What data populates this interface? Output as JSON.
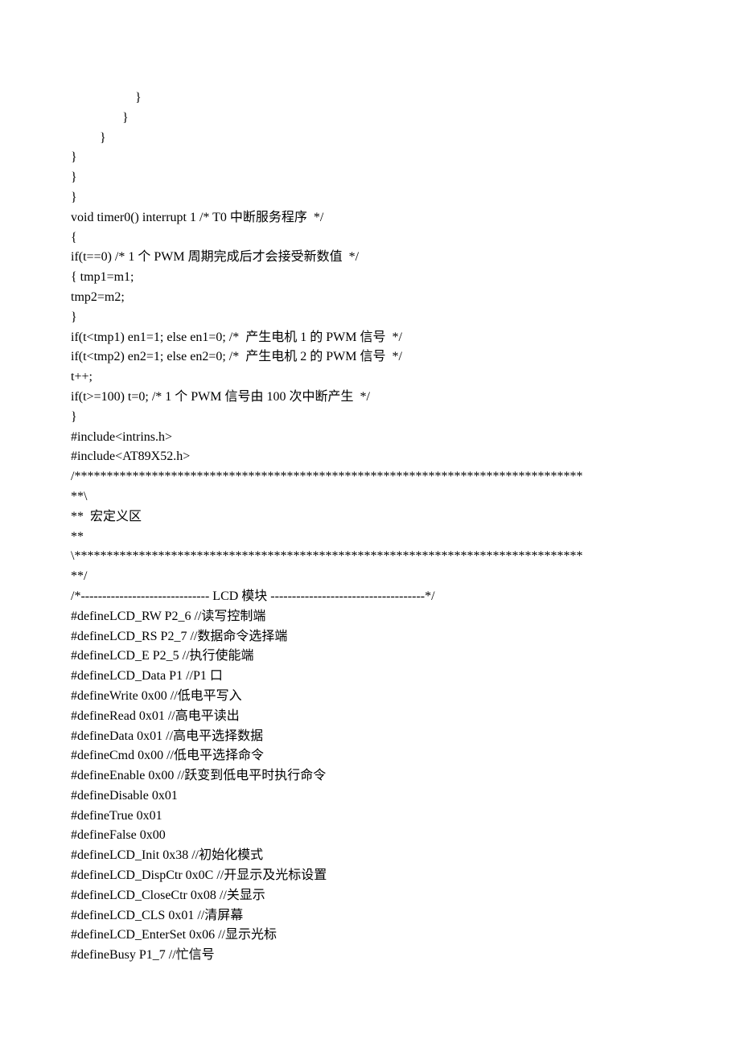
{
  "lines": [
    "                    }",
    "                }",
    "         }",
    "}",
    "}",
    "}",
    "void timer0() interrupt 1 /* T0 中断服务程序  */",
    "{",
    "if(t==0) /* 1 个 PWM 周期完成后才会接受新数值  */",
    "{ tmp1=m1;",
    "tmp2=m2;",
    "}",
    "if(t<tmp1) en1=1; else en1=0; /*  产生电机 1 的 PWM 信号  */",
    "if(t<tmp2) en2=1; else en2=0; /*  产生电机 2 的 PWM 信号  */",
    "t++;",
    "if(t>=100) t=0; /* 1 个 PWM 信号由 100 次中断产生  */",
    "}",
    "#include<intrins.h>",
    "#include<AT89X52.h>",
    "/*******************************************************************************",
    "**\\",
    "**  宏定义区",
    "**",
    "\\*******************************************************************************",
    "**/",
    "/*------------------------------ LCD 模块 ------------------------------------*/",
    "#defineLCD_RW P2_6 //读写控制端",
    "#defineLCD_RS P2_7 //数据命令选择端",
    "#defineLCD_E P2_5 //执行使能端",
    "#defineLCD_Data P1 //P1 口",
    "#defineWrite 0x00 //低电平写入",
    "#defineRead 0x01 //高电平读出",
    "#defineData 0x01 //高电平选择数据",
    "#defineCmd 0x00 //低电平选择命令",
    "#defineEnable 0x00 //跃变到低电平时执行命令",
    "#defineDisable 0x01",
    "#defineTrue 0x01",
    "#defineFalse 0x00",
    "#defineLCD_Init 0x38 //初始化模式",
    "#defineLCD_DispCtr 0x0C //开显示及光标设置",
    "#defineLCD_CloseCtr 0x08 //关显示",
    "#defineLCD_CLS 0x01 //清屏幕",
    "#defineLCD_EnterSet 0x06 //显示光标",
    "#defineBusy P1_7 //忙信号"
  ]
}
